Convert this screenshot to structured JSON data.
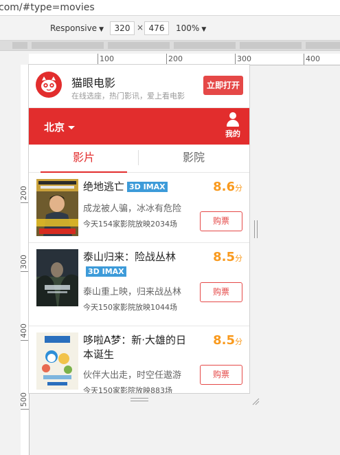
{
  "browser": {
    "url": "com/#type=movies",
    "device_mode": "Responsive",
    "width": "320",
    "height": "476",
    "size_separator": "×",
    "zoom": "100%"
  },
  "rulers": {
    "horizontal_labels": [
      "100",
      "200",
      "300",
      "400"
    ],
    "vertical_labels": [
      "200",
      "300",
      "400",
      "500"
    ]
  },
  "app_banner": {
    "name": "猫眼电影",
    "subtitle": "在线选座，热门影讯，爱上看电影",
    "open_button": "立即打开",
    "logo_icon": "maoyan-cat-logo-icon"
  },
  "header": {
    "city": "北京",
    "mine_label": "我的"
  },
  "tabs": [
    {
      "label": "影片",
      "active": true
    },
    {
      "label": "影院",
      "active": false
    }
  ],
  "movies": [
    {
      "title": "绝地逃亡",
      "badge": "3D IMAX",
      "score": "8.6",
      "score_unit": "分",
      "description": "成龙被人骗，冰冰有危险",
      "showings": "今天154家影院放映2034场",
      "buy_label": "购票",
      "poster_text": "7月21日 暑期狂欢"
    },
    {
      "title": "泰山归来：险战丛林",
      "badge": "3D IMAX",
      "score": "8.5",
      "score_unit": "分",
      "description": "泰山重上映，归来战丛林",
      "showings": "今天150家影院放映1044场",
      "buy_label": "购票",
      "poster_text": "泰山归来"
    },
    {
      "title": "哆啦A梦：新·大雄的日本诞生",
      "badge": "",
      "score": "8.5",
      "score_unit": "分",
      "description": "伙伴大出走，时空任遨游",
      "showings": "今天150家影院放映883场",
      "buy_label": "购票",
      "poster_text": "7.22 一起嗨"
    }
  ],
  "colors": {
    "brand_red": "#e22d2d",
    "score_orange": "#f99a1e",
    "badge_blue": "#3d9bd9"
  }
}
